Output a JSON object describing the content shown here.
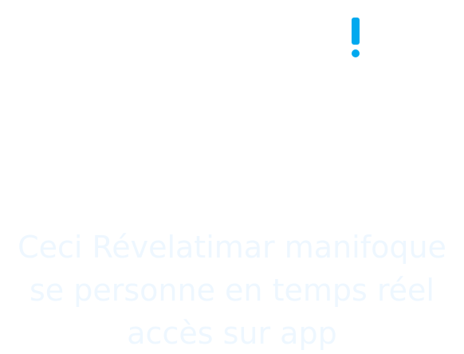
{
  "alert": {
    "icon": "exclamation-icon",
    "color": "#00a9ef"
  },
  "message": {
    "line_1": "Ceci Révelatimar manifoque",
    "line_2": "se personne en temps réel",
    "line_3": "accès sur app"
  }
}
